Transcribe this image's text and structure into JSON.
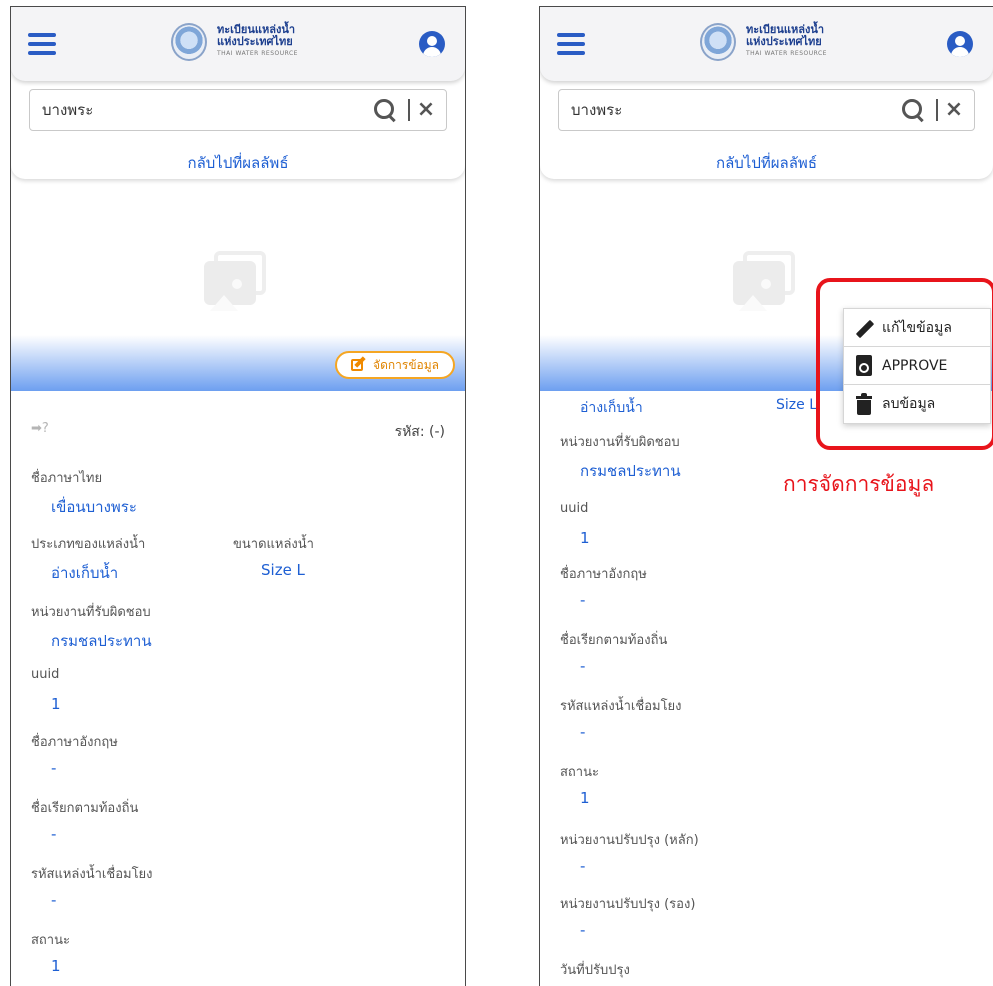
{
  "app": {
    "logo_line1": "ทะเบียนแหล่งน้ำ",
    "logo_line2": "แห่งประเทศไทย",
    "logo_line3": "THAI WATER RESOURCE"
  },
  "search": {
    "value": "บางพระ",
    "back_link": "กลับไปที่ผลลัพธ์"
  },
  "manage_button": "จัดการข้อมูล",
  "record": {
    "code_label": "รหัส: (-)",
    "thai_name_label": "ชื่อภาษาไทย",
    "thai_name_value": "เขื่อนบางพระ",
    "type_label": "ประเภทของแหล่งน้ำ",
    "type_value": "อ่างเก็บน้ำ",
    "size_label": "ขนาดแหล่งน้ำ",
    "size_value": "Size L",
    "agency_label": "หน่วยงานที่รับผิดชอบ",
    "agency_value": "กรมชลประทาน",
    "uuid_label": "uuid",
    "uuid_value": "1",
    "eng_name_label": "ชื่อภาษาอังกฤษ",
    "eng_name_value": "-",
    "local_name_label": "ชื่อเรียกตามท้องถิ่น",
    "local_name_value": "-",
    "linked_code_label": "รหัสแหล่งน้ำเชื่อมโยง",
    "linked_code_value": "-",
    "status_label": "สถานะ",
    "status_value": "1",
    "main_updater_label": "หน่วยงานปรับปรุง (หลัก)",
    "main_updater_value": "-",
    "sub_updater_label": "หน่วยงานปรับปรุง (รอง)",
    "sub_updater_value": "-",
    "updated_date_label": "วันที่ปรับปรุง",
    "size_partial": "Size L"
  },
  "action_menu": {
    "edit": "แก้ไขข้อมูล",
    "approve": "APPROVE",
    "delete": "ลบข้อมูล"
  },
  "annotation": {
    "callout": "การจัดการข้อมูล",
    "color": "#e8141b"
  },
  "colors": {
    "primary": "#2a5cc4",
    "link": "#1e5fd3",
    "accent": "#f5a623"
  }
}
